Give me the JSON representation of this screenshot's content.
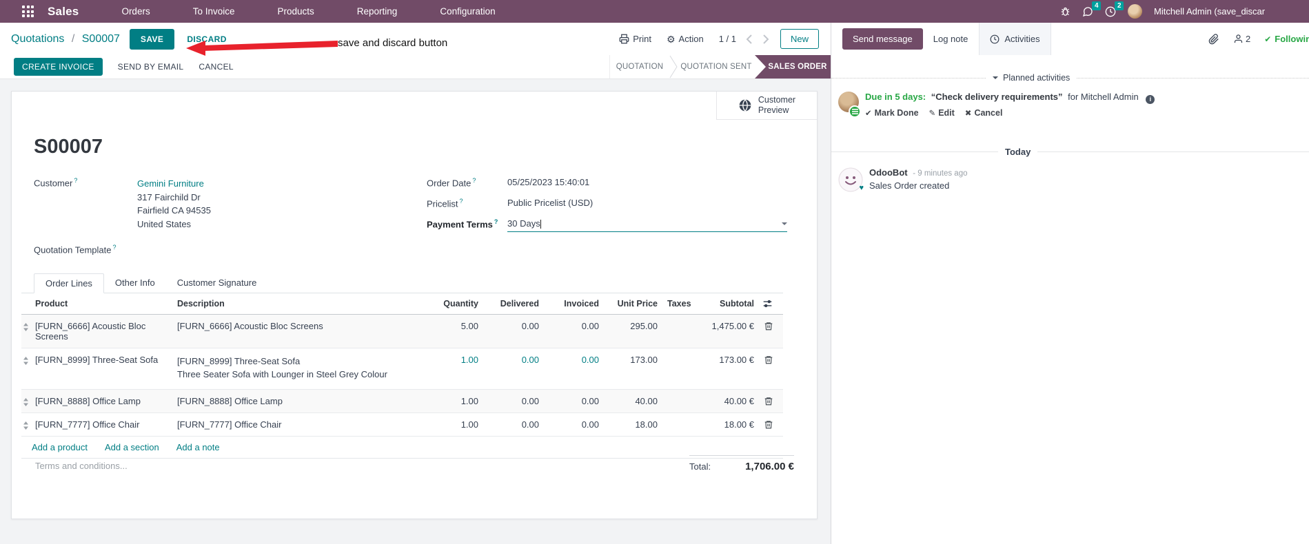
{
  "navbar": {
    "app_name": "Sales",
    "menus": [
      "Orders",
      "To Invoice",
      "Products",
      "Reporting",
      "Configuration"
    ],
    "message_count": "4",
    "activity_count": "2",
    "user_name": "Mitchell Admin (save_discar"
  },
  "control_panel": {
    "breadcrumb_parent": "Quotations",
    "breadcrumb_sep": "/",
    "breadcrumb_current": "S00007",
    "save": "SAVE",
    "discard": "DISCARD",
    "annotation": "save and discard button",
    "print": "Print",
    "action": "Action",
    "pager": "1 / 1",
    "new": "New"
  },
  "action_buttons": {
    "create_invoice": "CREATE INVOICE",
    "send_by_email": "SEND BY EMAIL",
    "cancel": "CANCEL"
  },
  "statusbar": {
    "step1": "QUOTATION",
    "step2": "QUOTATION SENT",
    "step3": "SALES ORDER"
  },
  "sheet": {
    "customer_preview_line1": "Customer",
    "customer_preview_line2": "Preview",
    "title": "S00007",
    "help_marker": "?",
    "customer_label": "Customer",
    "customer_name": "Gemini Furniture",
    "customer_street": "317 Fairchild Dr",
    "customer_city": "Fairfield CA 94535",
    "customer_country": "United States",
    "quotation_template_label": "Quotation Template",
    "order_date_label": "Order Date",
    "order_date": "05/25/2023 15:40:01",
    "pricelist_label": "Pricelist",
    "pricelist": "Public Pricelist (USD)",
    "payment_terms_label": "Payment Terms",
    "payment_terms": "30 Days"
  },
  "tabs": {
    "order_lines": "Order Lines",
    "other_info": "Other Info",
    "customer_signature": "Customer Signature"
  },
  "order_table": {
    "headers": {
      "product": "Product",
      "description": "Description",
      "quantity": "Quantity",
      "delivered": "Delivered",
      "invoiced": "Invoiced",
      "unit_price": "Unit Price",
      "taxes": "Taxes",
      "subtotal": "Subtotal"
    },
    "rows": [
      {
        "product": "[FURN_6666] Acoustic Bloc Screens",
        "description": "[FURN_6666] Acoustic Bloc Screens",
        "description2": "",
        "quantity": "5.00",
        "delivered": "0.00",
        "invoiced": "0.00",
        "unit_price": "295.00",
        "taxes": "",
        "subtotal": "1,475.00 €"
      },
      {
        "product": "[FURN_8999] Three-Seat Sofa",
        "description": "[FURN_8999] Three-Seat Sofa",
        "description2": "Three Seater Sofa with Lounger in Steel Grey Colour",
        "quantity": "1.00",
        "delivered": "0.00",
        "invoiced": "0.00",
        "unit_price": "173.00",
        "taxes": "",
        "subtotal": "173.00 €"
      },
      {
        "product": "[FURN_8888] Office Lamp",
        "description": "[FURN_8888] Office Lamp",
        "description2": "",
        "quantity": "1.00",
        "delivered": "0.00",
        "invoiced": "0.00",
        "unit_price": "40.00",
        "taxes": "",
        "subtotal": "40.00 €"
      },
      {
        "product": "[FURN_7777] Office Chair",
        "description": "[FURN_7777] Office Chair",
        "description2": "",
        "quantity": "1.00",
        "delivered": "0.00",
        "invoiced": "0.00",
        "unit_price": "18.00",
        "taxes": "",
        "subtotal": "18.00 €"
      }
    ],
    "add_product": "Add a product",
    "add_section": "Add a section",
    "add_note": "Add a note",
    "terms_placeholder": "Terms and conditions...",
    "total_label": "Total:",
    "total_value": "1,706.00 €"
  },
  "chatter": {
    "send_message": "Send message",
    "log_note": "Log note",
    "activities": "Activities",
    "follower_count": "2",
    "following": "Following",
    "planned_activities": "Planned activities",
    "activity_due": "Due in 5 days:",
    "activity_summary": "“Check delivery requirements”",
    "activity_for": "for Mitchell Admin",
    "mark_done": "Mark Done",
    "edit": "Edit",
    "cancel": "Cancel",
    "today": "Today",
    "message_author": "OdooBot",
    "message_time": "- 9 minutes ago",
    "message_body": "Sales Order created"
  },
  "icons": {
    "gear": "⚙",
    "check": "✔",
    "pencil": "✎",
    "cross": "✖",
    "heart": "♥",
    "info": "i"
  },
  "colors": {
    "navbar": "#714B67",
    "accent_teal": "#017E84",
    "badge_teal": "#00A09D",
    "status_active": "#714B67",
    "green": "#28a745",
    "annotation_red": "#E8222C"
  }
}
